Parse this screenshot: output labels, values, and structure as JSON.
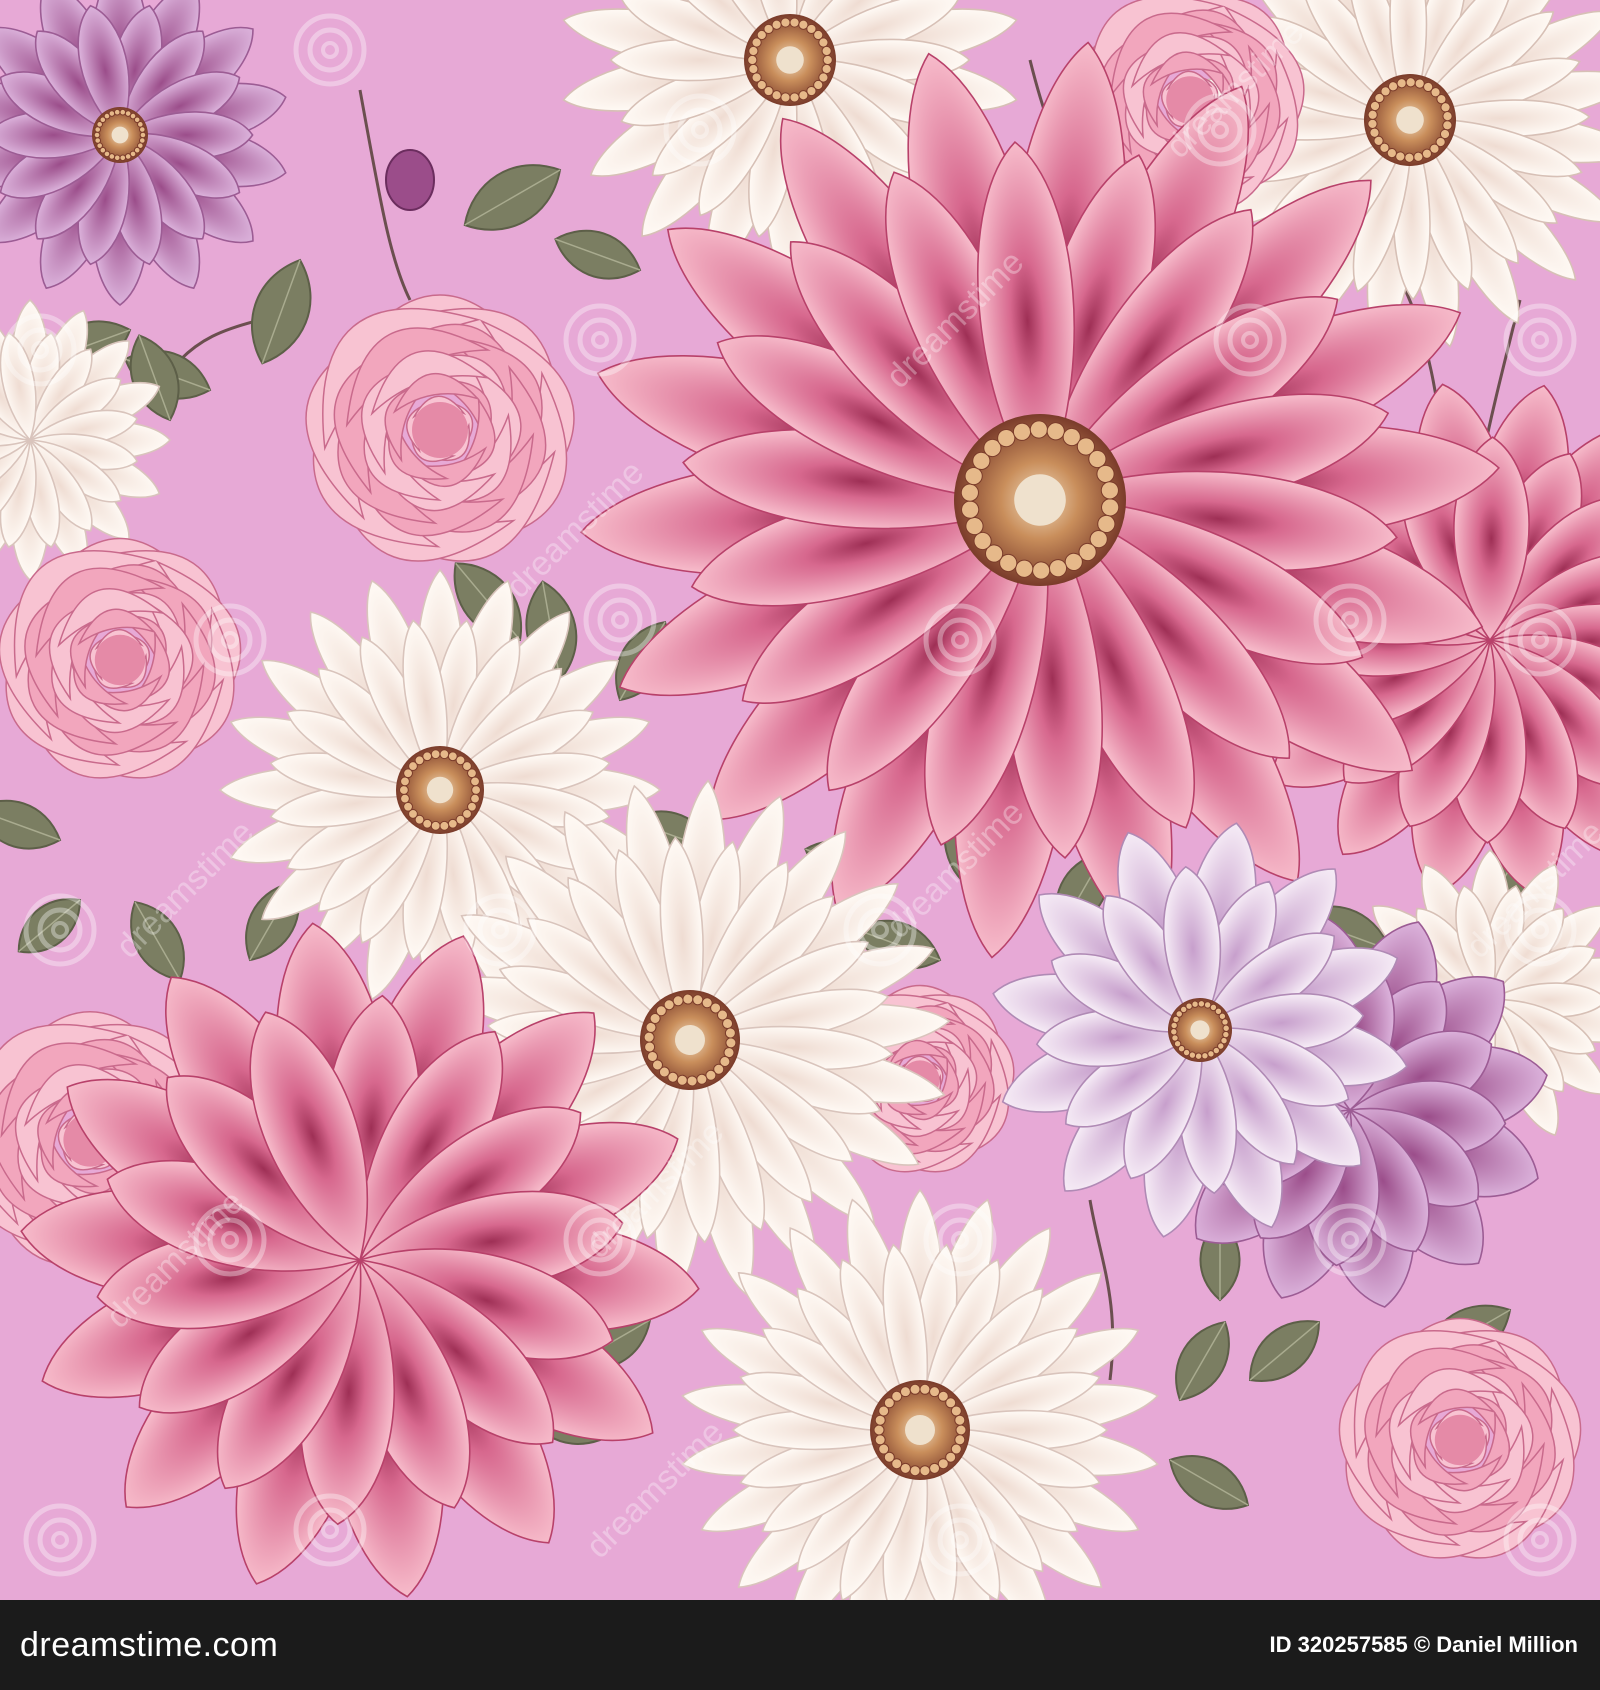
{
  "image": {
    "description_colors": {
      "background": "#e7a9d6",
      "pink_light": "#f4b7c7",
      "pink_mid": "#e9849e",
      "pink_deep": "#b8416a",
      "white_petal": "#fbf3ee",
      "lilac": "#c493c4",
      "leaf": "#7b7e62",
      "center_gold": "#c98e5b",
      "center_dark": "#7a3b2a"
    },
    "watermark_text": "dreamstime"
  },
  "footer": {
    "site": "dreamstime.com",
    "credit": "ID 320257585 © Daniel Million"
  }
}
